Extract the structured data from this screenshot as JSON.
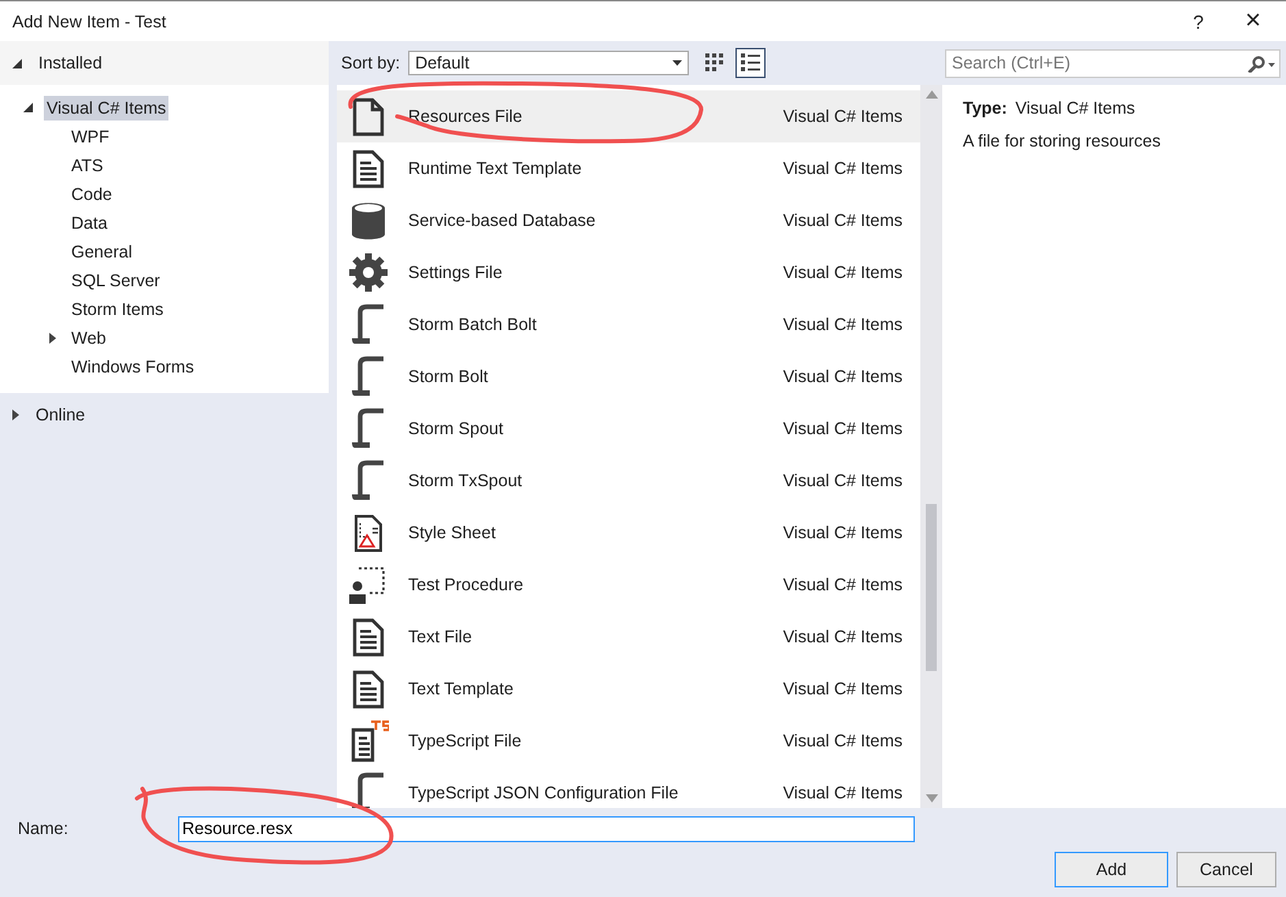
{
  "window": {
    "title": "Add New Item - Test",
    "help": "?",
    "close": "×"
  },
  "tree": [
    {
      "label": "Installed",
      "expanded": true,
      "children": [
        {
          "label": "Visual C# Items",
          "expanded": true,
          "selected": true,
          "children": [
            {
              "label": "WPF",
              "selected": false
            },
            {
              "label": "ATS",
              "selected": false
            },
            {
              "label": "Code",
              "selected": false
            },
            {
              "label": "Data",
              "selected": false
            },
            {
              "label": "General",
              "selected": false
            },
            {
              "label": "SQL Server",
              "selected": false
            },
            {
              "label": "Storm Items",
              "selected": false
            },
            {
              "label": "Web",
              "expanded": false,
              "selected": false
            },
            {
              "label": "Windows Forms",
              "selected": false
            }
          ]
        }
      ]
    },
    {
      "label": "Online",
      "expanded": false
    }
  ],
  "toolbar": {
    "sort_label": "Sort by:",
    "sort_value": "Default",
    "view_buttons": [
      {
        "selected": false
      },
      {
        "selected": true
      }
    ]
  },
  "search": {
    "placeholder": "Search (Ctrl+E)"
  },
  "items": [
    {
      "name": "Resources File",
      "category": "Visual C# Items",
      "selected": true
    },
    {
      "name": "Runtime Text Template",
      "category": "Visual C# Items",
      "selected": false
    },
    {
      "name": "Service-based Database",
      "category": "Visual C# Items",
      "selected": false
    },
    {
      "name": "Settings File",
      "category": "Visual C# Items",
      "selected": false
    },
    {
      "name": "Storm Batch Bolt",
      "category": "Visual C# Items",
      "selected": false
    },
    {
      "name": "Storm Bolt",
      "category": "Visual C# Items",
      "selected": false
    },
    {
      "name": "Storm Spout",
      "category": "Visual C# Items",
      "selected": false
    },
    {
      "name": "Storm TxSpout",
      "category": "Visual C# Items",
      "selected": false
    },
    {
      "name": "Style Sheet",
      "category": "Visual C# Items",
      "selected": false
    },
    {
      "name": "Test Procedure",
      "category": "Visual C# Items",
      "selected": false
    },
    {
      "name": "Text File",
      "category": "Visual C# Items",
      "selected": false
    },
    {
      "name": "Text Template",
      "category": "Visual C# Items",
      "selected": false
    },
    {
      "name": "TypeScript File",
      "category": "Visual C# Items",
      "selected": false
    },
    {
      "name": "TypeScript JSON Configuration File",
      "category": "Visual C# Items",
      "selected": false
    }
  ],
  "details": {
    "type_label": "Type:",
    "type_value": "Visual C# Items",
    "description": "A file for storing resources"
  },
  "name_field": {
    "label": "Name:",
    "value": "Resource.resx"
  },
  "buttons": [
    "Add",
    "Cancel"
  ]
}
